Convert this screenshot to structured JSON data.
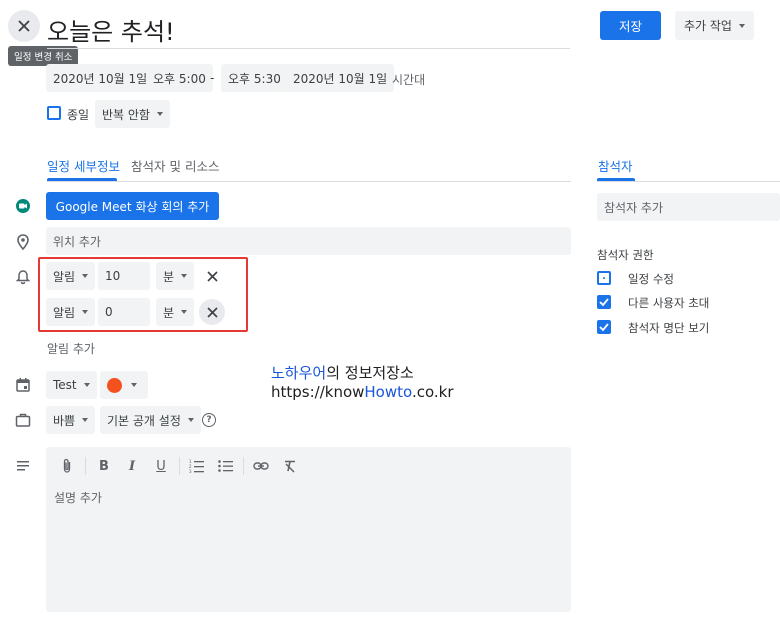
{
  "header": {
    "title": "오늘은 추석!",
    "close_tooltip": "일정 변경 취소",
    "save_label": "저장",
    "more_actions_label": "추가 작업"
  },
  "datetime": {
    "start_date": "2020년 10월 1일",
    "start_time": "오후 5:00",
    "separator": "-",
    "end_time": "오후 5:30",
    "end_date": "2020년 10월 1일",
    "timezone_label": "시간대",
    "all_day_label": "종일",
    "repeat_label": "반복 안함"
  },
  "tabs": [
    {
      "label": "일정 세부정보",
      "active": true
    },
    {
      "label": "참석자 및 리소스",
      "active": false
    }
  ],
  "meet_button_label": "Google Meet 화상 회의 추가",
  "location_placeholder": "위치 추가",
  "notifications": [
    {
      "type": "알림",
      "value": "10",
      "unit": "분"
    },
    {
      "type": "알림",
      "value": "0",
      "unit": "분"
    }
  ],
  "add_notification_label": "알림 추가",
  "calendar": {
    "name": "Test",
    "color": "#f4511e"
  },
  "availability": {
    "busy_label": "바쁨",
    "visibility_label": "기본 공개 설정"
  },
  "description_placeholder": "설명 추가",
  "watermark": {
    "line1_highlight": "노하우어",
    "line1_rest": "의 정보저장소",
    "line2_pre": "https://know",
    "line2_highlight": "Howto",
    "line2_post": ".co.kr"
  },
  "guests": {
    "heading": "참석자",
    "add_placeholder": "참석자 추가",
    "permissions_heading": "참석자 권한",
    "permissions": [
      {
        "label": "일정 수정",
        "checked": false
      },
      {
        "label": "다른 사용자 초대",
        "checked": true
      },
      {
        "label": "참석자 명단 보기",
        "checked": true
      }
    ]
  },
  "colors": {
    "accent": "#1a73e8",
    "highlight_box": "#e53935",
    "watermark_blue": "#1a56db"
  }
}
